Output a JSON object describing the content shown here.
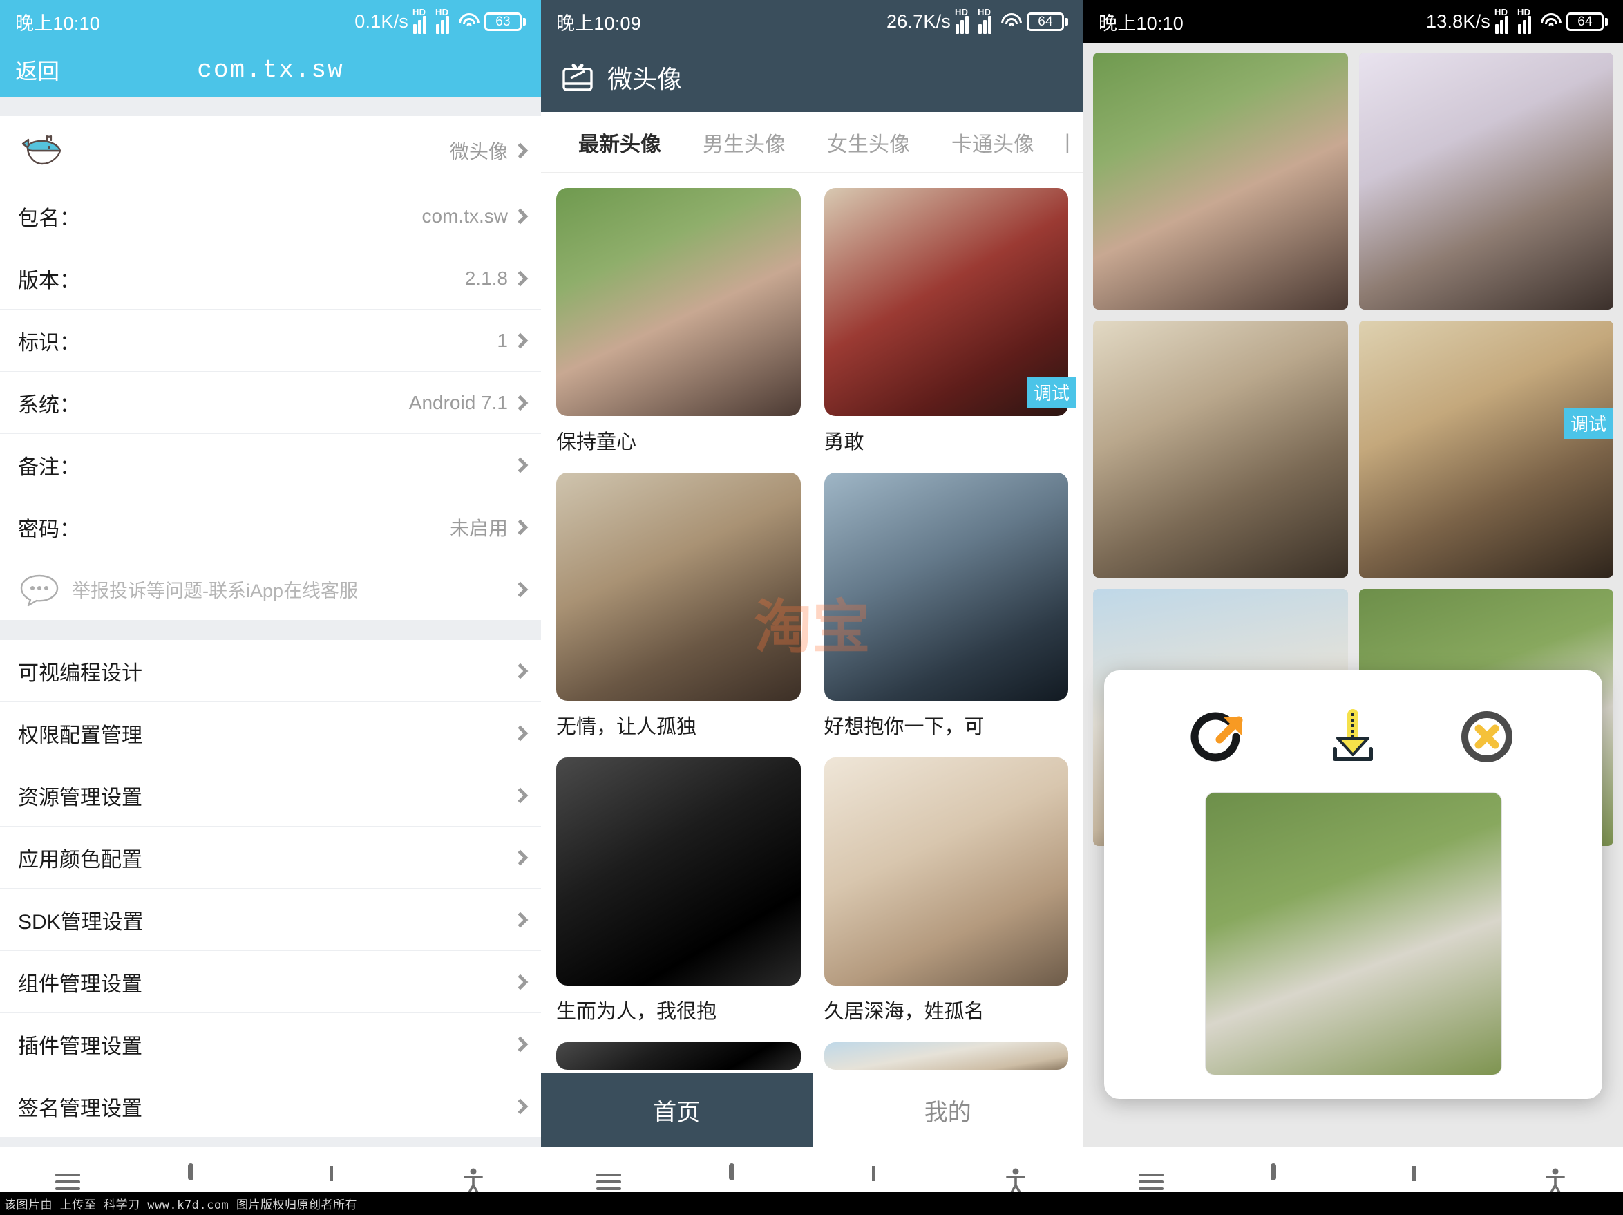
{
  "left": {
    "status": {
      "time": "晚上10:10",
      "speed": "0.1K/s",
      "battery": "63"
    },
    "nav": {
      "back_label": "返回",
      "app_title": "com.tx.sw"
    },
    "info_rows": [
      {
        "label": "",
        "value": "微头像",
        "icon": "whale-icon"
      },
      {
        "label": "包名：",
        "value": "com.tx.sw"
      },
      {
        "label": "版本：",
        "value": "2.1.8"
      },
      {
        "label": "标识：",
        "value": "1"
      },
      {
        "label": "系统：",
        "value": "Android 7.1"
      },
      {
        "label": "备注：",
        "value": ""
      },
      {
        "label": "密码：",
        "value": "未启用"
      }
    ],
    "support_row": {
      "text": "举报投诉等问题-联系iApp在线客服",
      "icon": "chat-bubble-icon"
    },
    "menu_rows": [
      "可视编程设计",
      "权限配置管理",
      "资源管理设置",
      "应用颜色配置",
      "SDK管理设置",
      "组件管理设置",
      "插件管理设置",
      "签名管理设置"
    ]
  },
  "middle": {
    "status": {
      "time": "晚上10:09",
      "speed": "26.7K/s",
      "battery": "64"
    },
    "header": {
      "title": "微头像",
      "icon": "gift-box-icon"
    },
    "tabs": [
      {
        "label": "最新头像",
        "active": true
      },
      {
        "label": "男生头像",
        "active": false
      },
      {
        "label": "女生头像",
        "active": false
      },
      {
        "label": "卡通头像",
        "active": false
      }
    ],
    "cards": [
      {
        "caption": "保持童心",
        "photo": "girl-holding-goldfish-bag"
      },
      {
        "caption": "勇敢",
        "photo": "spiderman-mirror-selfie",
        "debug_badge": "调试"
      },
      {
        "caption": "无情，让人孤独",
        "photo": "boy-with-beret-hat"
      },
      {
        "caption": "好想抱你一下，可",
        "photo": "boy-with-glasses"
      },
      {
        "caption": "生而为人，我很抱",
        "photo": "dark-silhouette-hoodie"
      },
      {
        "caption": "久居深海，姓孤名",
        "photo": "girl-sleeping-beige"
      }
    ],
    "watermark": "淘宝",
    "bottom_nav": [
      {
        "label": "首页",
        "active": true
      },
      {
        "label": "我的",
        "active": false
      }
    ]
  },
  "right": {
    "status": {
      "time": "晚上10:10",
      "speed": "13.8K/s",
      "battery": "64"
    },
    "grid_photos": [
      "girl-holding-goldfish-bag",
      "girl-with-bubbles",
      "girl-sunglasses-coffee",
      "girl-knit-sweater",
      "girl-white-cap",
      "goats-on-grass"
    ],
    "debug_badge": "调试",
    "modal": {
      "actions": [
        {
          "name": "share-refresh",
          "icon": "circular-arrow-icon"
        },
        {
          "name": "download",
          "icon": "download-icon"
        },
        {
          "name": "close",
          "icon": "close-circle-icon"
        }
      ],
      "preview_photo": "goats-on-grass"
    }
  },
  "navbar": {
    "items": [
      {
        "icon": "menu-icon"
      },
      {
        "icon": "home-square-icon"
      },
      {
        "icon": "back-chevron-icon"
      },
      {
        "icon": "accessibility-icon"
      }
    ]
  },
  "footer_watermark": "该图片由  上传至 科学刀 www.k7d.com  图片版权归原创者所有",
  "colors": {
    "left_accent": "#4bc4e8",
    "mid_header": "#3a4e5c",
    "debug_badge": "#4bc4e8",
    "download_arrow": "#f5e14a",
    "share_arrow": "#f79a23",
    "close_cross": "#f5c13a"
  }
}
